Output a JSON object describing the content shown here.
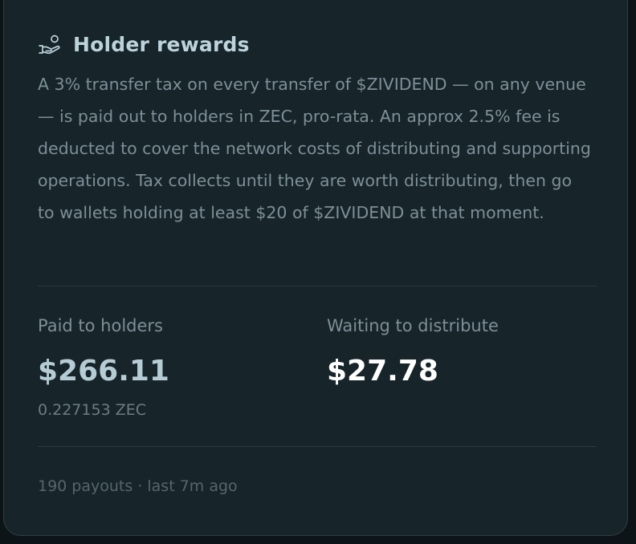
{
  "card": {
    "icon": "hand-coins-icon",
    "title": "Holder rewards",
    "description": "A 3% transfer tax on every transfer of $ZIVIDEND — on any venue — is paid out to holders in ZEC, pro-rata. An approx 2.5% fee is deducted to cover the network costs of distributing and supporting operations. Tax collects until they are worth distributing, then go to wallets holding at least $20 of $ZIVIDEND at that moment."
  },
  "stats": {
    "paid": {
      "label": "Paid to holders",
      "value": "$266.11",
      "sub": "0.227153 ZEC"
    },
    "waiting": {
      "label": "Waiting to distribute",
      "value": "$27.78"
    }
  },
  "footer": {
    "text": "190 payouts · last 7m ago"
  },
  "colors": {
    "card_bg": "#17242a",
    "title": "#bcd3dc",
    "muted": "#7e8f97",
    "highlight": "#ffffff"
  }
}
